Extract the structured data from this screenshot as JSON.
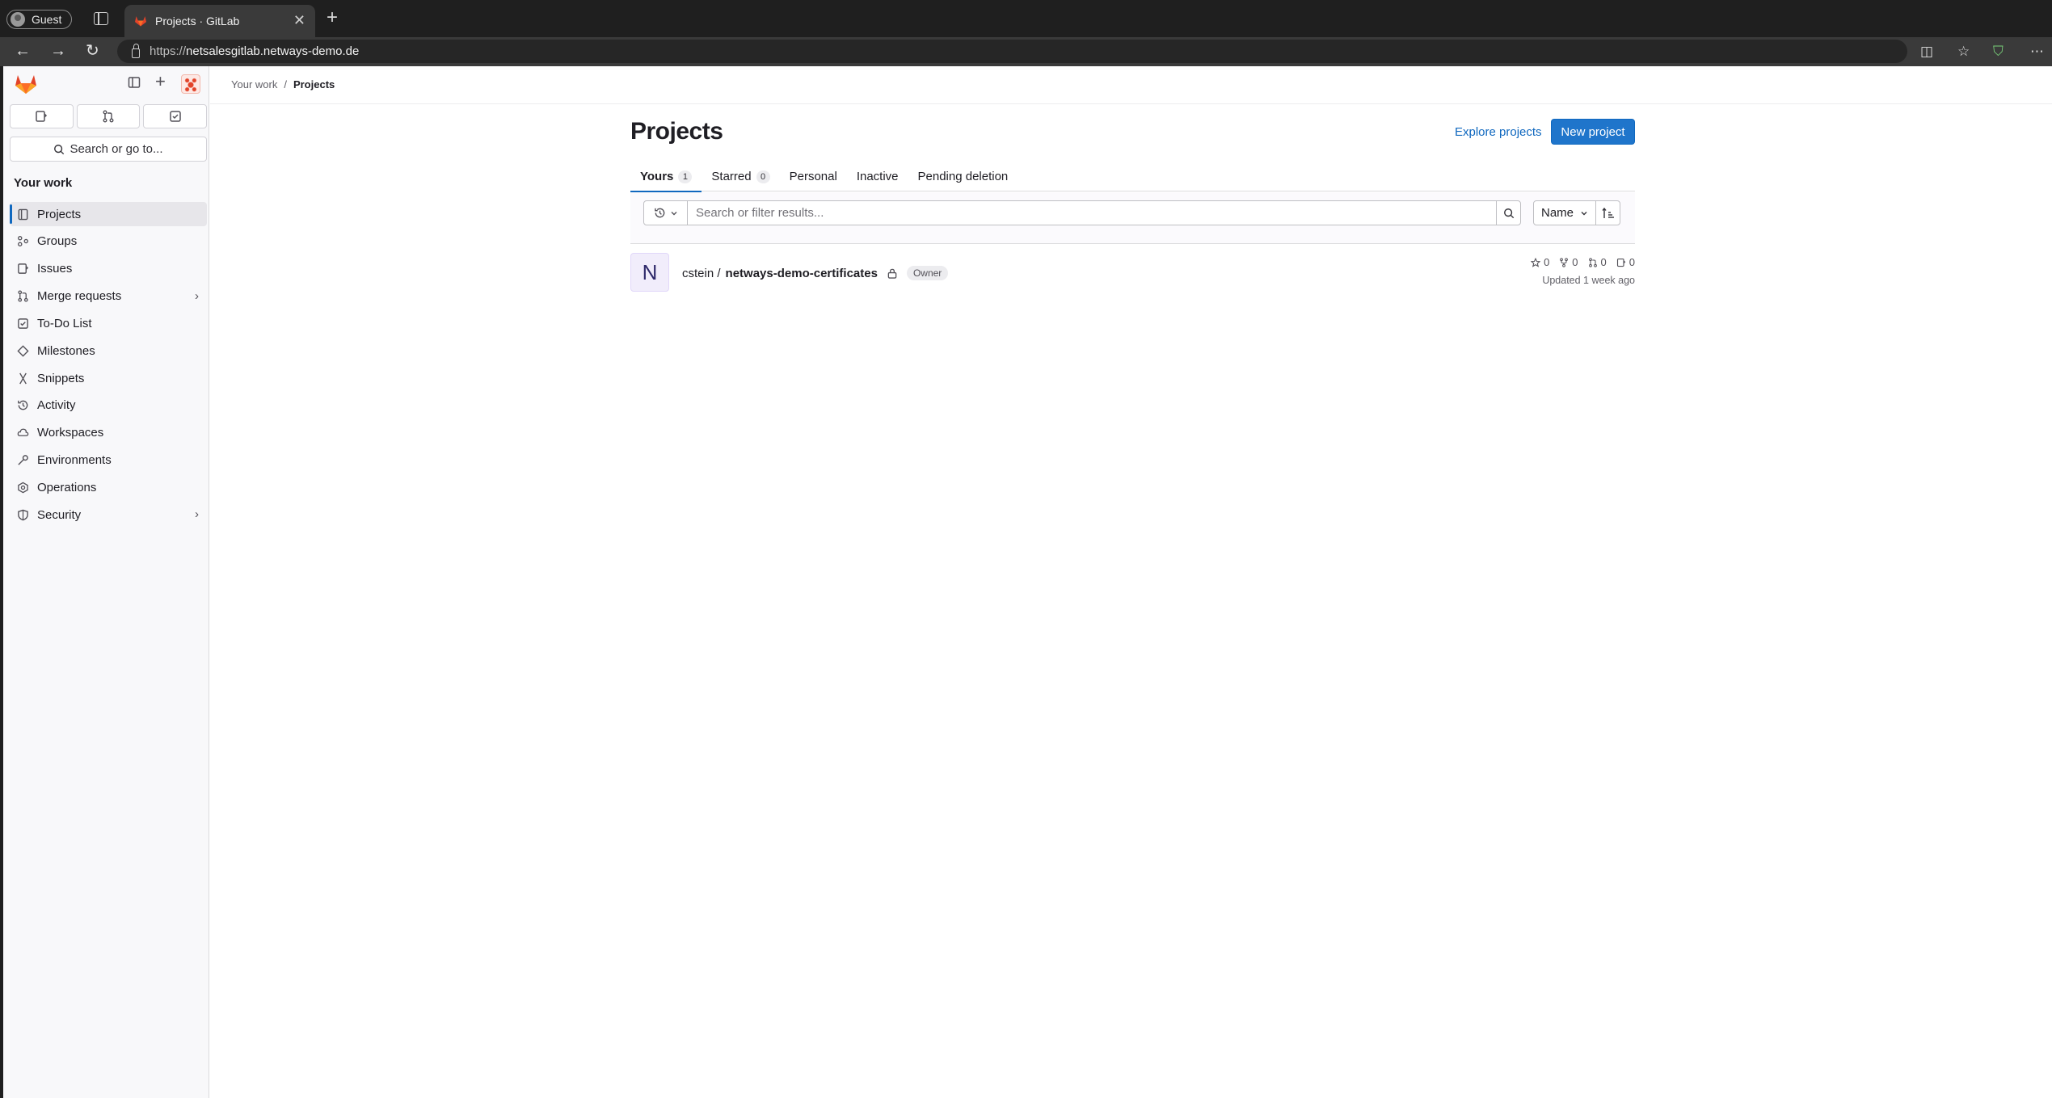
{
  "browser": {
    "profile_label": "Guest",
    "tab_title": "Projects · GitLab",
    "url_scheme": "https://",
    "url_host": "netsalesgitlab.netways-demo.de"
  },
  "sidebar": {
    "search_label": "Search or go to...",
    "section_heading": "Your work",
    "items": [
      {
        "label": "Projects",
        "icon": "project-icon"
      },
      {
        "label": "Groups",
        "icon": "group-icon"
      },
      {
        "label": "Issues",
        "icon": "issues-icon"
      },
      {
        "label": "Merge requests",
        "icon": "merge-request-icon"
      },
      {
        "label": "To-Do List",
        "icon": "todo-icon"
      },
      {
        "label": "Milestones",
        "icon": "milestone-icon"
      },
      {
        "label": "Snippets",
        "icon": "snippet-icon"
      },
      {
        "label": "Activity",
        "icon": "history-icon"
      },
      {
        "label": "Workspaces",
        "icon": "workspace-icon"
      },
      {
        "label": "Environments",
        "icon": "environment-icon"
      },
      {
        "label": "Operations",
        "icon": "operations-icon"
      },
      {
        "label": "Security",
        "icon": "shield-icon"
      }
    ]
  },
  "breadcrumb": {
    "parent": "Your work",
    "separator": "/",
    "current": "Projects"
  },
  "page": {
    "title": "Projects",
    "explore_label": "Explore projects",
    "new_project_label": "New project"
  },
  "tabs": [
    {
      "label": "Yours",
      "count": "1"
    },
    {
      "label": "Starred",
      "count": "0"
    },
    {
      "label": "Personal"
    },
    {
      "label": "Inactive"
    },
    {
      "label": "Pending deletion"
    }
  ],
  "filter": {
    "placeholder": "Search or filter results...",
    "sort_label": "Name"
  },
  "projects": [
    {
      "avatar_letter": "N",
      "namespace": "cstein /",
      "name": "netways-demo-certificates",
      "role": "Owner",
      "stars": "0",
      "forks": "0",
      "merge_requests": "0",
      "issues": "0",
      "updated": "Updated 1 week ago"
    }
  ],
  "colors": {
    "accent": "#1f75cb",
    "link": "#1068bf",
    "gitlab_orange": "#e24329"
  }
}
